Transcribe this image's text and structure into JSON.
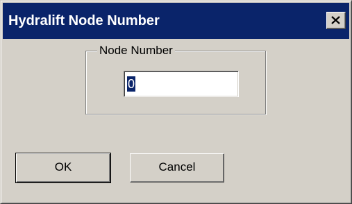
{
  "dialog": {
    "title": "Hydralift Node Number",
    "close_icon": "close-icon"
  },
  "group": {
    "label": "Node Number",
    "input_value": "0"
  },
  "buttons": {
    "ok_label": "OK",
    "cancel_label": "Cancel"
  },
  "colors": {
    "titlebar": "#0a246a",
    "face": "#d4d0c8",
    "selection": "#0a246a"
  }
}
